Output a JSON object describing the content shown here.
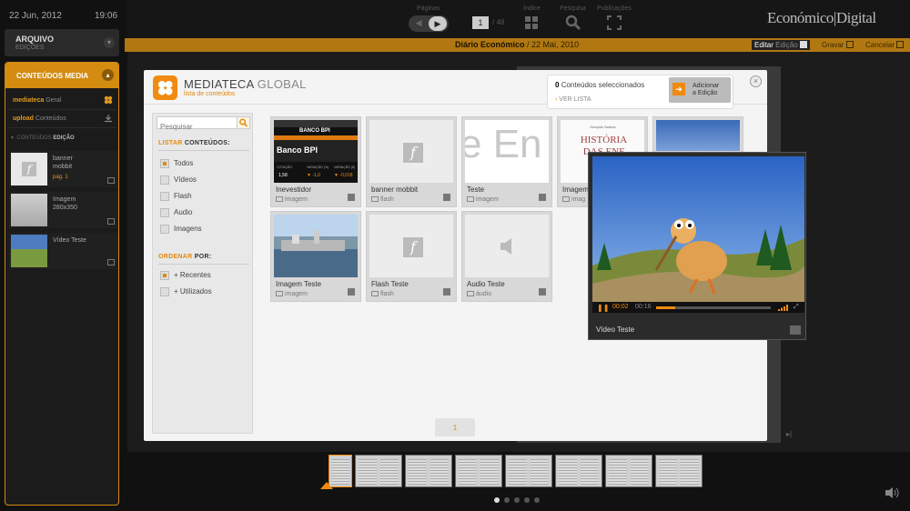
{
  "sidebar": {
    "date": "22 Jun, 2012",
    "time": "19:06",
    "archive_title": "ARQUIVO",
    "archive_sub": "EDIÇÕES",
    "panel_title": "CONTEÚDOS MEDIA",
    "mediateca_a": "mediateca",
    "mediateca_b": "Geral",
    "upload_a": "upload",
    "upload_b": "Conteúdos",
    "sub_a": "CONTEÚDOS",
    "sub_b": "EDIÇÃO",
    "items": [
      {
        "name": "banner mobbit",
        "page": "pág. 1"
      },
      {
        "name": "Imagem 280x350",
        "page": ""
      },
      {
        "name": "Vídeo Teste",
        "page": ""
      }
    ]
  },
  "topbar": {
    "paginas_label": "Páginas",
    "page_num": "1",
    "page_total": "/ 48",
    "indice_label": "Índice",
    "pesquisa_label": "Pesquisa",
    "publicacoes_label": "Publicações",
    "logo": "Económico|Digital"
  },
  "orangebar": {
    "title": "Diário Económico",
    "date": "/ 22 Mai, 2010",
    "editar": "Editar",
    "edicao": "Edição",
    "gravar": "Gravar",
    "cancelar": "Cancelar"
  },
  "modal": {
    "title_a": "MEDIATECA",
    "title_b": "GLOBAL",
    "subtitle": "lista de conteúdos",
    "count": "0",
    "count_label": "Conteúdos seleccionados",
    "ver_lista": "VER LISTA",
    "add_label_1": "Adicionar",
    "add_label_2": "a Edição",
    "search_placeholder": "Pesquisar",
    "list_a": "LISTAR",
    "list_b": "CONTEÚDOS:",
    "filters": [
      "Todos",
      "Vídeos",
      "Flash",
      "Audio",
      "Imagens"
    ],
    "order_a": "ORDENAR",
    "order_b": "POR:",
    "orders": [
      "+ Recentes",
      "+ Utilizados"
    ],
    "page": "1",
    "tiles": [
      {
        "name": "Inevestidor",
        "type": "imagem"
      },
      {
        "name": "banner mobbit",
        "type": "flash"
      },
      {
        "name": "Teste",
        "type": "imagem"
      },
      {
        "name": "Imagem",
        "type": "imag"
      },
      {
        "name": "",
        "type": ""
      },
      {
        "name": "Imagem Teste",
        "type": "imagem"
      },
      {
        "name": "Flash Teste",
        "type": "flash"
      },
      {
        "name": "Audio Teste",
        "type": "áudio"
      }
    ],
    "bpi_title": "BANCO BPI",
    "bpi_banner": "Banco BPI",
    "bpi_vals": [
      "1,58",
      "▼ -1,0",
      "▼ -0,018"
    ],
    "bpi_labels": [
      "COTAÇÃO",
      "VARIAÇÃO (%)",
      "VARIAÇÃO (€)"
    ],
    "book_author": "Gonçalo Santos",
    "book_title": "HISTÓRIA DAS ENF",
    "teste_text": "e En"
  },
  "video": {
    "current": "00:02",
    "total": "00:16",
    "progress": 0.17,
    "title": "Vídeo Teste"
  },
  "accent": "#f08a10"
}
